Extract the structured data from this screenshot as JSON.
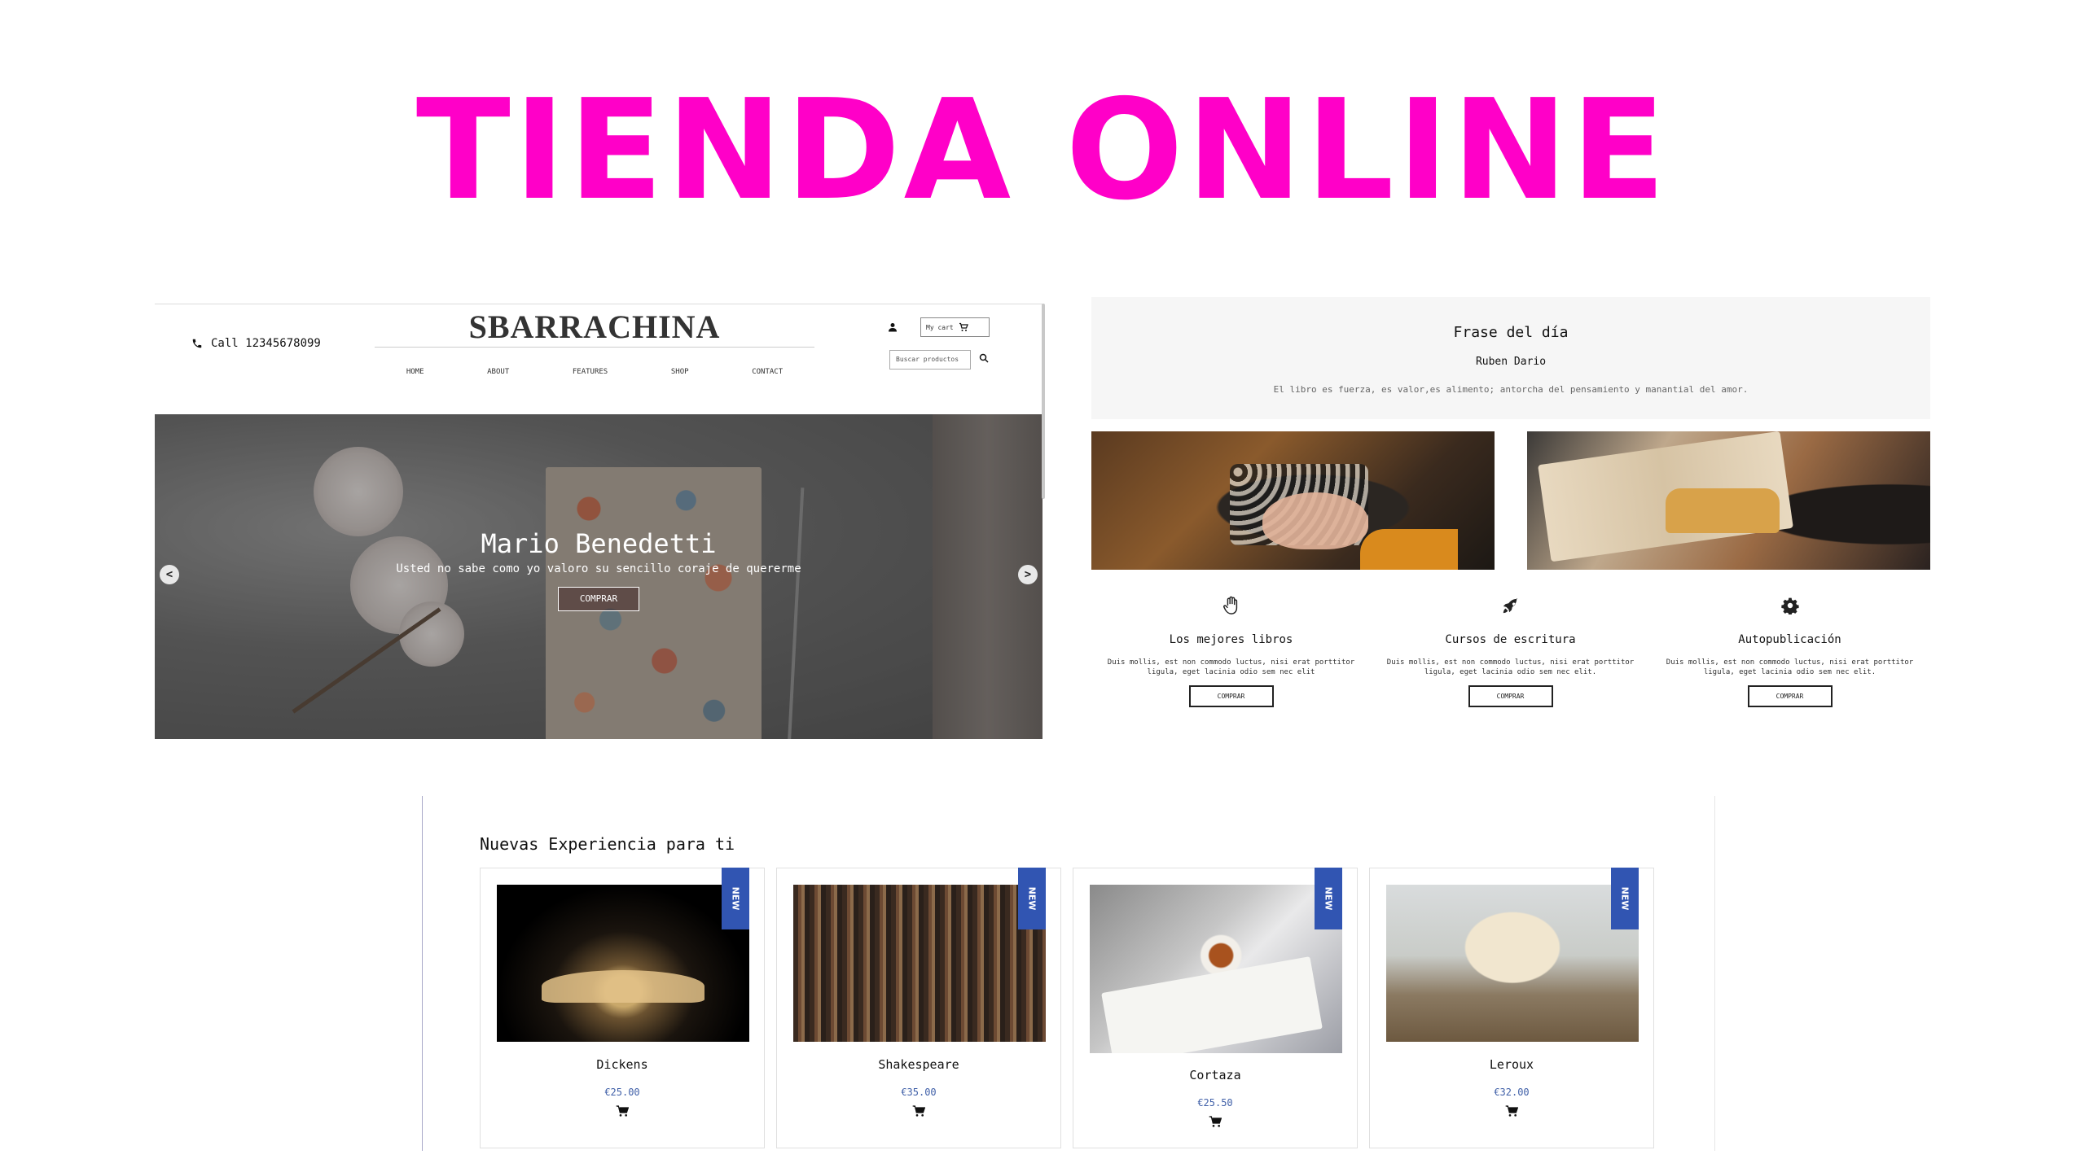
{
  "page_title": "TIENDA ONLINE",
  "homepage": {
    "phone_label": "Call 12345678099",
    "brand": "SBARRACHINA",
    "nav": [
      "HOME",
      "ABOUT",
      "FEATURES",
      "SHOP",
      "CONTACT"
    ],
    "cart_label": "My cart",
    "search_placeholder": "Buscar productos",
    "hero": {
      "title": "Mario Benedetti",
      "subtitle": "Usted no sabe como yo valoro su sencillo coraje de quererme",
      "button": "COMPRAR",
      "prev": "<",
      "next": ">"
    }
  },
  "features_panel": {
    "quote_title": "Frase del día",
    "quote_author": "Ruben Dario",
    "quote_text": "El libro es fuerza, es valor,es alimento; antorcha del pensamiento y manantial del amor.",
    "features": [
      {
        "icon": "hand-icon",
        "title": "Los mejores libros",
        "desc": "Duis mollis, est non commodo luctus, nisi erat porttitor ligula, eget lacinia odio sem nec elit",
        "button": "COMPRAR"
      },
      {
        "icon": "rocket-icon",
        "title": "Cursos de escritura",
        "desc": "Duis mollis, est non commodo luctus, nisi erat porttitor ligula, eget lacinia odio sem nec elit.",
        "button": "COMPRAR"
      },
      {
        "icon": "gear-icon",
        "title": "Autopublicación",
        "desc": "Duis mollis, est non commodo luctus, nisi erat porttitor ligula, eget lacinia odio sem nec elit.",
        "button": "COMPRAR"
      }
    ]
  },
  "products": {
    "section_title": "Nuevas Experiencia para ti",
    "badge": "NEW",
    "items": [
      {
        "name": "Dickens",
        "price": "€25.00"
      },
      {
        "name": "Shakespeare",
        "price": "€35.00"
      },
      {
        "name": "Cortaza",
        "price": "€25.50"
      },
      {
        "name": "Leroux",
        "price": "€32.00"
      }
    ]
  },
  "colors": {
    "title": "#ff00c8",
    "badge": "#3155b2",
    "price": "#4060a8"
  }
}
